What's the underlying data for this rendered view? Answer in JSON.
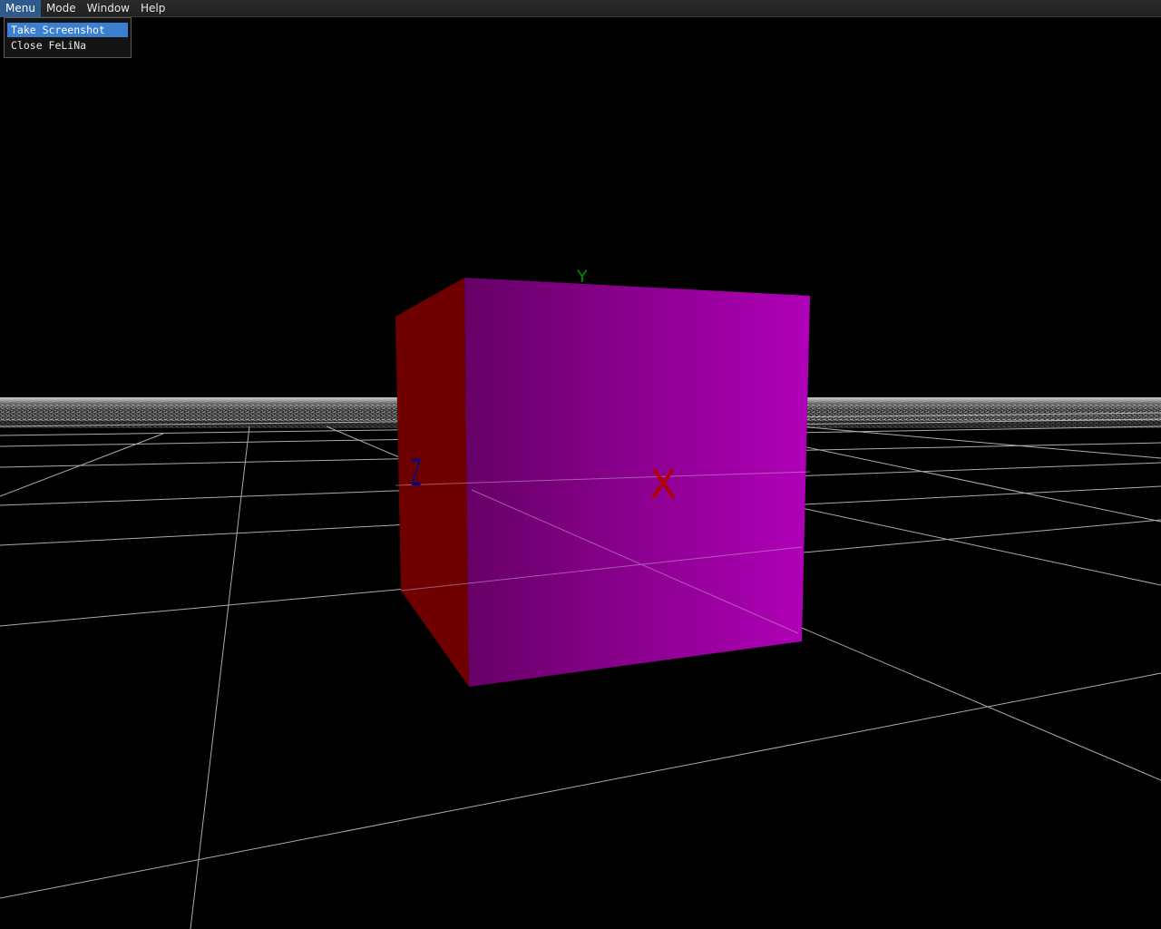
{
  "menubar": {
    "items": [
      {
        "label": "Menu",
        "active": true
      },
      {
        "label": "Mode",
        "active": false
      },
      {
        "label": "Window",
        "active": false
      },
      {
        "label": "Help",
        "active": false
      }
    ]
  },
  "dropdown": {
    "items": [
      {
        "label": "Take Screenshot",
        "highlighted": true
      },
      {
        "label": "Close FeLiNa",
        "highlighted": false
      }
    ]
  },
  "scene": {
    "background_color": "#000000",
    "grid_color": "#bfbfbf",
    "cube_front_color": "#b000b8",
    "cube_side_color": "#6e0000",
    "axis_labels": {
      "x": "X",
      "y": "Y",
      "z": "Z"
    },
    "axis_colors": {
      "x": "#b00000",
      "y": "#008a00",
      "z": "#000080"
    }
  }
}
